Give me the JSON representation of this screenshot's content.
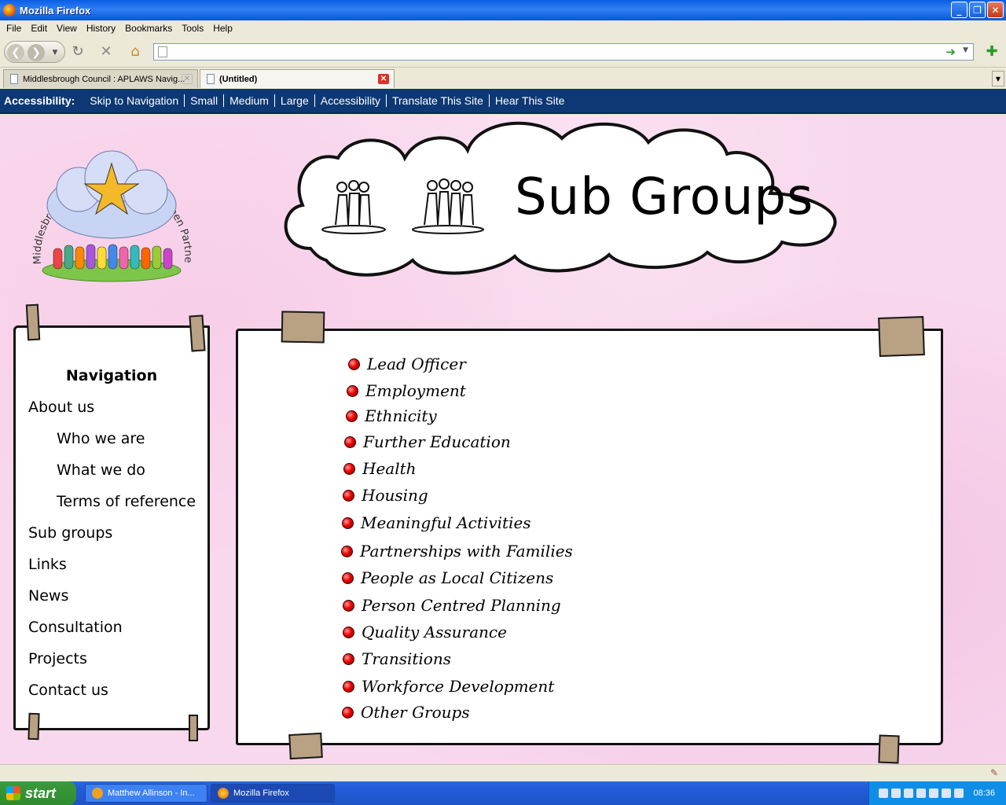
{
  "window": {
    "title": "Mozilla Firefox"
  },
  "menu": [
    "File",
    "Edit",
    "View",
    "History",
    "Bookmarks",
    "Tools",
    "Help"
  ],
  "tabs": [
    {
      "label": "Middlesbrough Council : APLAWS Navig..."
    },
    {
      "label": "(Untitled)"
    }
  ],
  "accessibility": {
    "label": "Accessibility:",
    "links": [
      "Skip to Navigation",
      "Small",
      "Medium",
      "Large",
      "Accessibility",
      "Translate This Site",
      "Hear This Site"
    ]
  },
  "logo": {
    "text": "Middlesbrough Learning Disability Open Partnership Board"
  },
  "banner": {
    "title": "Sub Groups"
  },
  "nav": {
    "heading": "Navigation",
    "items": [
      "About us",
      "Who we are",
      "What we do",
      "Terms of reference",
      "Sub groups",
      "Links",
      "News",
      "Consultation",
      "Projects",
      "Contact us"
    ]
  },
  "groups": [
    "Lead Officer",
    "Employment",
    "Ethnicity",
    "Further Education",
    "Health",
    "Housing",
    "Meaningful Activities",
    "Partnerships with Families",
    "People as Local Citizens",
    "Person Centred Planning",
    "Quality Assurance",
    "Transitions",
    "Workforce Development",
    "Other Groups"
  ],
  "taskbar": {
    "start": "start",
    "tasks": [
      "Matthew Allinson - In...",
      "Mozilla Firefox"
    ],
    "clock": "08:36"
  }
}
